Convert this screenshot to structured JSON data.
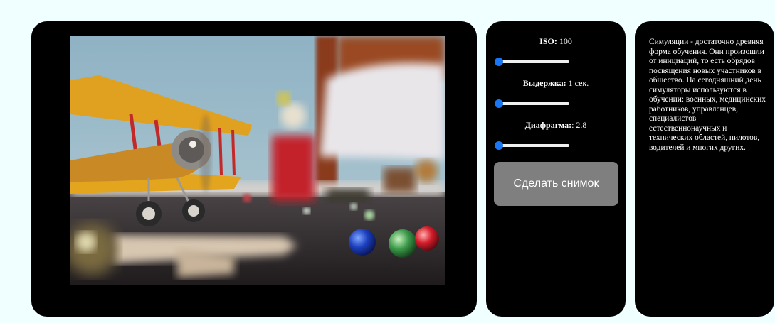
{
  "controls": {
    "iso": {
      "label": "ISO:",
      "value": "100",
      "level": 0
    },
    "shutter": {
      "label": "Выдержка:",
      "value": "1 сек.",
      "level": 0
    },
    "aperture": {
      "label": "Диафрагма:",
      "value": ": 2.8",
      "level": 0
    },
    "snap_label": "Сделать снимок",
    "accent_color": "#1976f5"
  },
  "info": {
    "text": "Симуляции - достаточно древняя форма обучения. Они произошли от инициаций, то есть обрядов посвящения новых участников в общество. На сегодняшний день симуляторы используются в обучении: военных, медицинских работников, управленцев, специалистов естественнонаучных и технических областей, пилотов, водителей и многих других."
  },
  "colors": {
    "page_background": "#f0ffff",
    "panel_background": "#000000",
    "button_background": "#7f7f7f"
  }
}
